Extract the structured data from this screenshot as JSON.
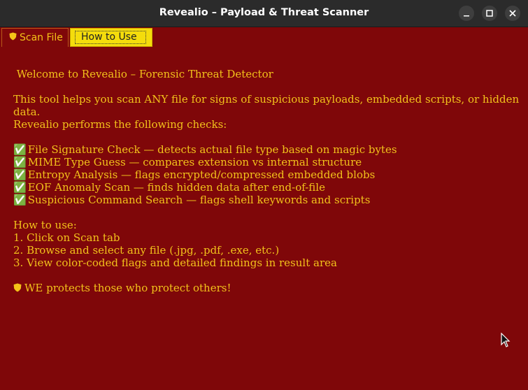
{
  "window": {
    "title": "Revealio – Payload & Threat Scanner",
    "controls": [
      "minimize",
      "maximize",
      "close"
    ]
  },
  "tabs": [
    {
      "label": "Scan File",
      "icon": "shield-icon",
      "selected": false
    },
    {
      "label": "How to Use",
      "selected": true
    }
  ],
  "content": {
    "heading": " Welcome to Revealio – Forensic Threat Detector",
    "intro1": "This tool helps you scan ANY file for signs of suspicious payloads, embedded scripts, or hidden",
    "intro2": "data.",
    "intro3": "Revealio performs the following checks:",
    "checks": [
      "File Signature Check — detects actual file type based on magic bytes",
      "MIME Type Guess — compares extension vs internal structure",
      "Entropy Analysis — flags encrypted/compressed embedded blobs",
      "EOF Anomaly Scan — finds hidden data after end-of-file",
      "Suspicious Command Search — flags shell keywords and scripts"
    ],
    "howto_title": "How to use:",
    "steps": [
      "1. Click on Scan tab",
      "2. Browse and select any file (.jpg, .pdf, .exe, etc.)",
      "3. View color-coded flags and detailed findings in result area"
    ],
    "footer": "WE protects those who protect others!"
  },
  "colors": {
    "background": "#7f0709",
    "text": "#f2c21b",
    "active_tab": "#f4dc0c",
    "titlebar": "#2b2b2b"
  }
}
